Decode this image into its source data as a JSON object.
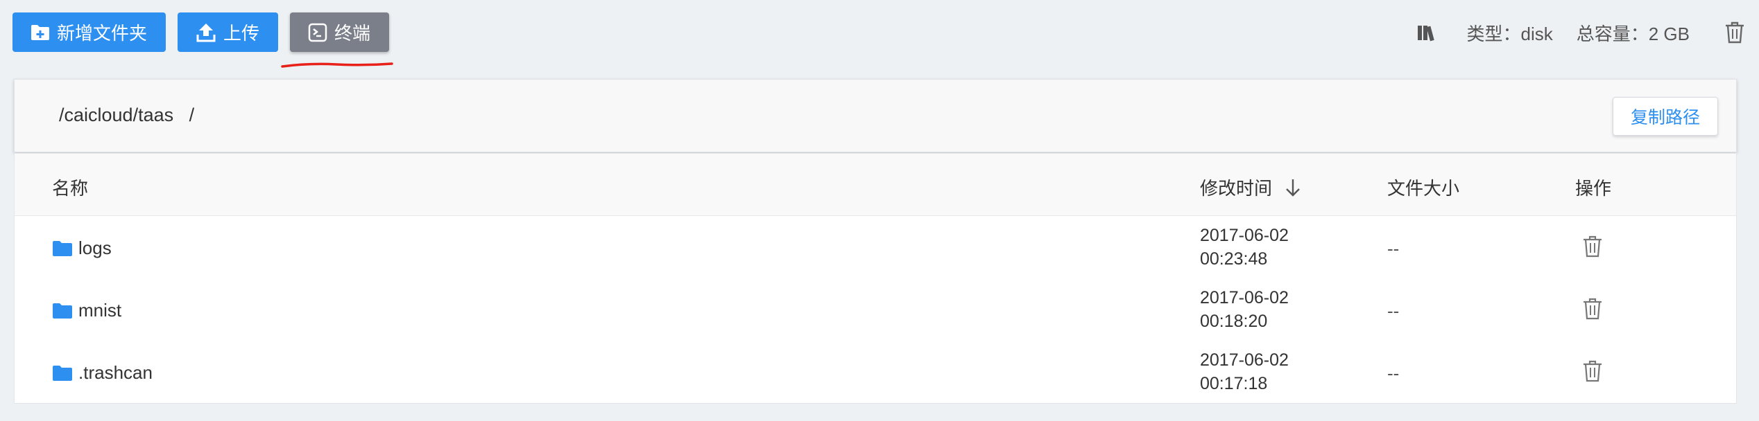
{
  "toolbar": {
    "new_folder_label": "新增文件夹",
    "upload_label": "上传",
    "terminal_label": "终端"
  },
  "storage": {
    "type_text": "类型：disk",
    "capacity_text": "总容量：2 GB"
  },
  "pathbar": {
    "path": "/caicloud/taas   /",
    "copy_label": "复制路径"
  },
  "table": {
    "headers": {
      "name": "名称",
      "mtime": "修改时间",
      "size": "文件大小",
      "ops": "操作"
    },
    "rows": [
      {
        "name": "logs",
        "date": "2017-06-02",
        "time": "00:23:48",
        "size": "--"
      },
      {
        "name": "mnist",
        "date": "2017-06-02",
        "time": "00:18:20",
        "size": "--"
      },
      {
        "name": ".trashcan",
        "date": "2017-06-02",
        "time": "00:17:18",
        "size": "--"
      }
    ]
  },
  "colors": {
    "primary": "#2d8ff0",
    "terminal_button": "#7a7f8a",
    "annotation": "#e8201a"
  },
  "icons": [
    "folder-plus-icon",
    "upload-icon",
    "terminal-icon",
    "books-icon",
    "trash-icon",
    "arrow-down-icon",
    "folder-icon"
  ]
}
